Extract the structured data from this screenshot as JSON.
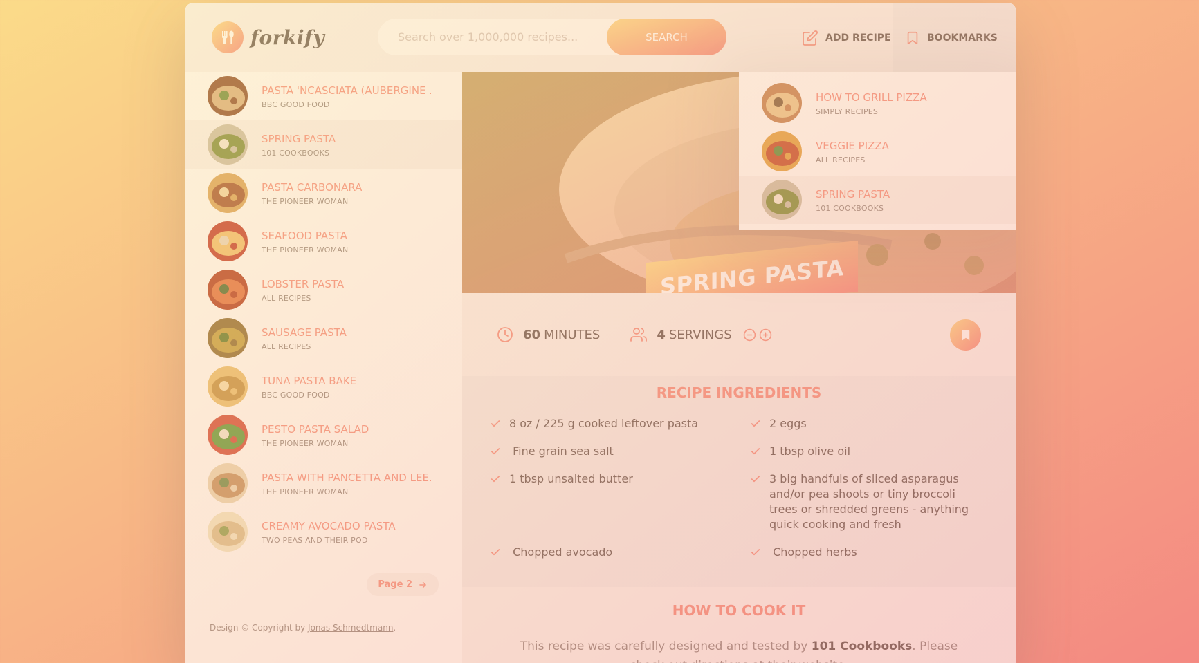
{
  "header": {
    "logo_text": "forkify",
    "search_placeholder": "Search over 1,000,000 recipes...",
    "search_button": "Search",
    "add_recipe": "Add recipe",
    "bookmarks": "Bookmarks"
  },
  "results": [
    {
      "title": "Pasta 'Ncasciata (Aubergine ...",
      "publisher": "BBC Good Food",
      "active": false
    },
    {
      "title": "Spring Pasta",
      "publisher": "101 Cookbooks",
      "active": true
    },
    {
      "title": "Pasta Carbonara",
      "publisher": "The Pioneer Woman",
      "active": false
    },
    {
      "title": "Seafood Pasta",
      "publisher": "The Pioneer Woman",
      "active": false
    },
    {
      "title": "Lobster Pasta",
      "publisher": "All Recipes",
      "active": false
    },
    {
      "title": "Sausage Pasta",
      "publisher": "All Recipes",
      "active": false
    },
    {
      "title": "Tuna Pasta Bake",
      "publisher": "BBC Good Food",
      "active": false
    },
    {
      "title": "Pesto Pasta Salad",
      "publisher": "The Pioneer Woman",
      "active": false
    },
    {
      "title": "Pasta with Pancetta and Lee...",
      "publisher": "The Pioneer Woman",
      "active": false
    },
    {
      "title": "Creamy Avocado Pasta",
      "publisher": "Two Peas and Their Pod",
      "active": false
    }
  ],
  "pagination": {
    "label": "Page 2"
  },
  "copyright": {
    "prefix": "Design © Copyright by ",
    "author": "Jonas Schmedtmann",
    "suffix": "."
  },
  "recipe": {
    "title": "Spring Pasta",
    "minutes": "60",
    "minutes_label": "minutes",
    "servings": "4",
    "servings_label": "servings",
    "ingredients_heading": "Recipe ingredients",
    "ingredients": [
      "8 oz / 225 g cooked leftover pasta",
      "2 eggs",
      " Fine grain sea salt",
      "1 tbsp olive oil",
      "1 tbsp unsalted butter",
      "3 big handfuls of sliced asparagus and/or pea shoots or tiny broccoli trees or shredded greens - anything quick cooking and fresh",
      " Chopped avocado",
      " Chopped herbs"
    ],
    "cook_heading": "How to cook it",
    "cook_text_prefix": "This recipe was carefully designed and tested by ",
    "cook_publisher": "101 Cookbooks",
    "cook_text_suffix": ". Please check out directions at their website."
  },
  "bookmarks": [
    {
      "title": "How to Grill Pizza",
      "publisher": "Simply Recipes",
      "active": false
    },
    {
      "title": "Veggie Pizza",
      "publisher": "All Recipes",
      "active": false
    },
    {
      "title": "Spring Pasta",
      "publisher": "101 Cookbooks",
      "active": true
    }
  ],
  "colors": {
    "primary": "#f38e82",
    "grad_start": "#fbdb89",
    "grad_end": "#f48982",
    "text": "#615551"
  },
  "icons": [
    "fork-spoon-icon",
    "edit-icon",
    "bookmark-icon",
    "arrow-right-icon",
    "clock-icon",
    "users-icon",
    "minus-circle-icon",
    "plus-circle-icon",
    "check-icon"
  ]
}
